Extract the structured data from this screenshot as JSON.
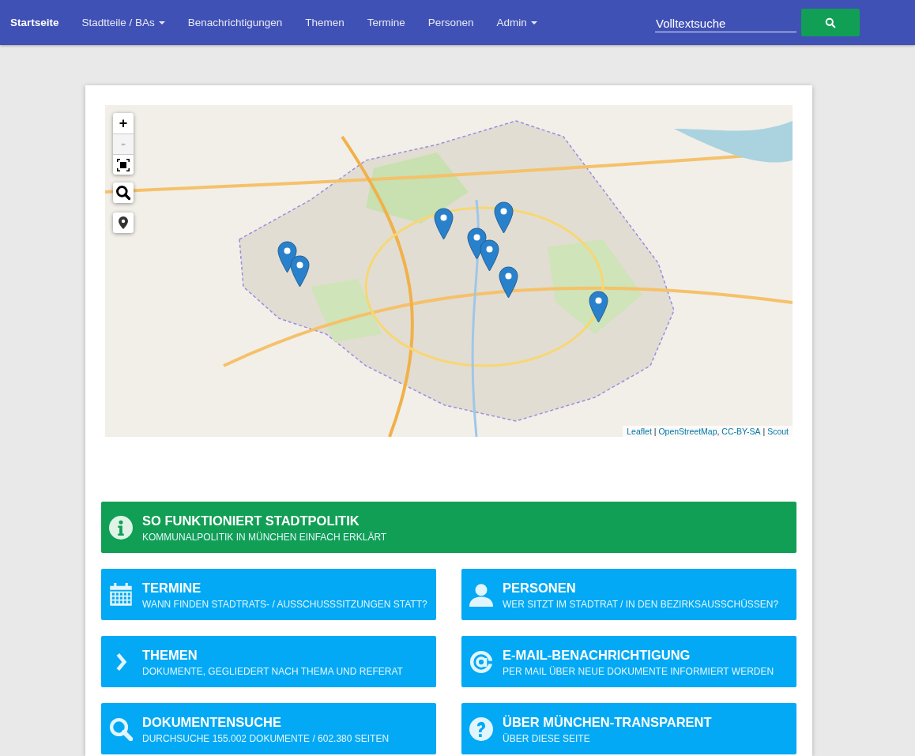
{
  "navbar": {
    "brand": "Startseite",
    "items": [
      {
        "label": "Stadtteile / BAs",
        "dropdown": true
      },
      {
        "label": "Benachrichtigungen",
        "dropdown": false
      },
      {
        "label": "Themen",
        "dropdown": false
      },
      {
        "label": "Termine",
        "dropdown": false
      },
      {
        "label": "Personen",
        "dropdown": false
      },
      {
        "label": "Admin",
        "dropdown": true
      }
    ],
    "search": {
      "placeholder": "Volltextsuche"
    }
  },
  "map": {
    "zoom_in": {
      "label": "+",
      "disabled": false
    },
    "zoom_out": {
      "label": "-",
      "disabled": true
    },
    "attribution": [
      {
        "kind": "link",
        "text": "Leaflet"
      },
      {
        "kind": "sep",
        "text": " | "
      },
      {
        "kind": "link",
        "text": "OpenStreetMap"
      },
      {
        "kind": "sep",
        "text": ", "
      },
      {
        "kind": "link",
        "text": "CC-BY-SA"
      },
      {
        "kind": "sep",
        "text": " | "
      },
      {
        "kind": "link",
        "text": "Scout"
      }
    ]
  },
  "tiles": [
    {
      "title": "SO FUNKTIONIERT STADTPOLITIK",
      "subtitle": "KOMMUNALPOLITIK IN MÜNCHEN EINFACH ERKLÄRT",
      "kind": "info",
      "color": "#119f55",
      "wide": true
    },
    {
      "title": "TERMINE",
      "subtitle": "WANN FINDEN STADTRATS- / AUSSCHUSSSITZUNGEN STATT?",
      "kind": "calendar",
      "color": "#03a9f4",
      "wide": false
    },
    {
      "title": "PERSONEN",
      "subtitle": "WER SITZT IM STADTRAT / IN DEN BEZIRKSAUSSCHÜSSEN?",
      "kind": "person",
      "color": "#03a9f4",
      "wide": false
    },
    {
      "title": "THEMEN",
      "subtitle": "DOKUMENTE, GEGLIEDERT NACH THEMA UND REFERAT",
      "kind": "chevron",
      "color": "#03a9f4",
      "wide": false
    },
    {
      "title": "E-MAIL-BENACHRICHTIGUNG",
      "subtitle": "PER MAIL ÜBER NEUE DOKUMENTE INFORMIERT WERDEN",
      "kind": "at",
      "color": "#03a9f4",
      "wide": false
    },
    {
      "title": "DOKUMENTENSUCHE",
      "subtitle": "DURCHSUCHE 155.002 DOKUMENTE / 602.380 SEITEN",
      "kind": "search",
      "color": "#03a9f4",
      "wide": false
    },
    {
      "title": "ÜBER MÜNCHEN-TRANSPARENT",
      "subtitle": "ÜBER DIESE SEITE",
      "kind": "question",
      "color": "#03a9f4",
      "wide": false
    }
  ]
}
